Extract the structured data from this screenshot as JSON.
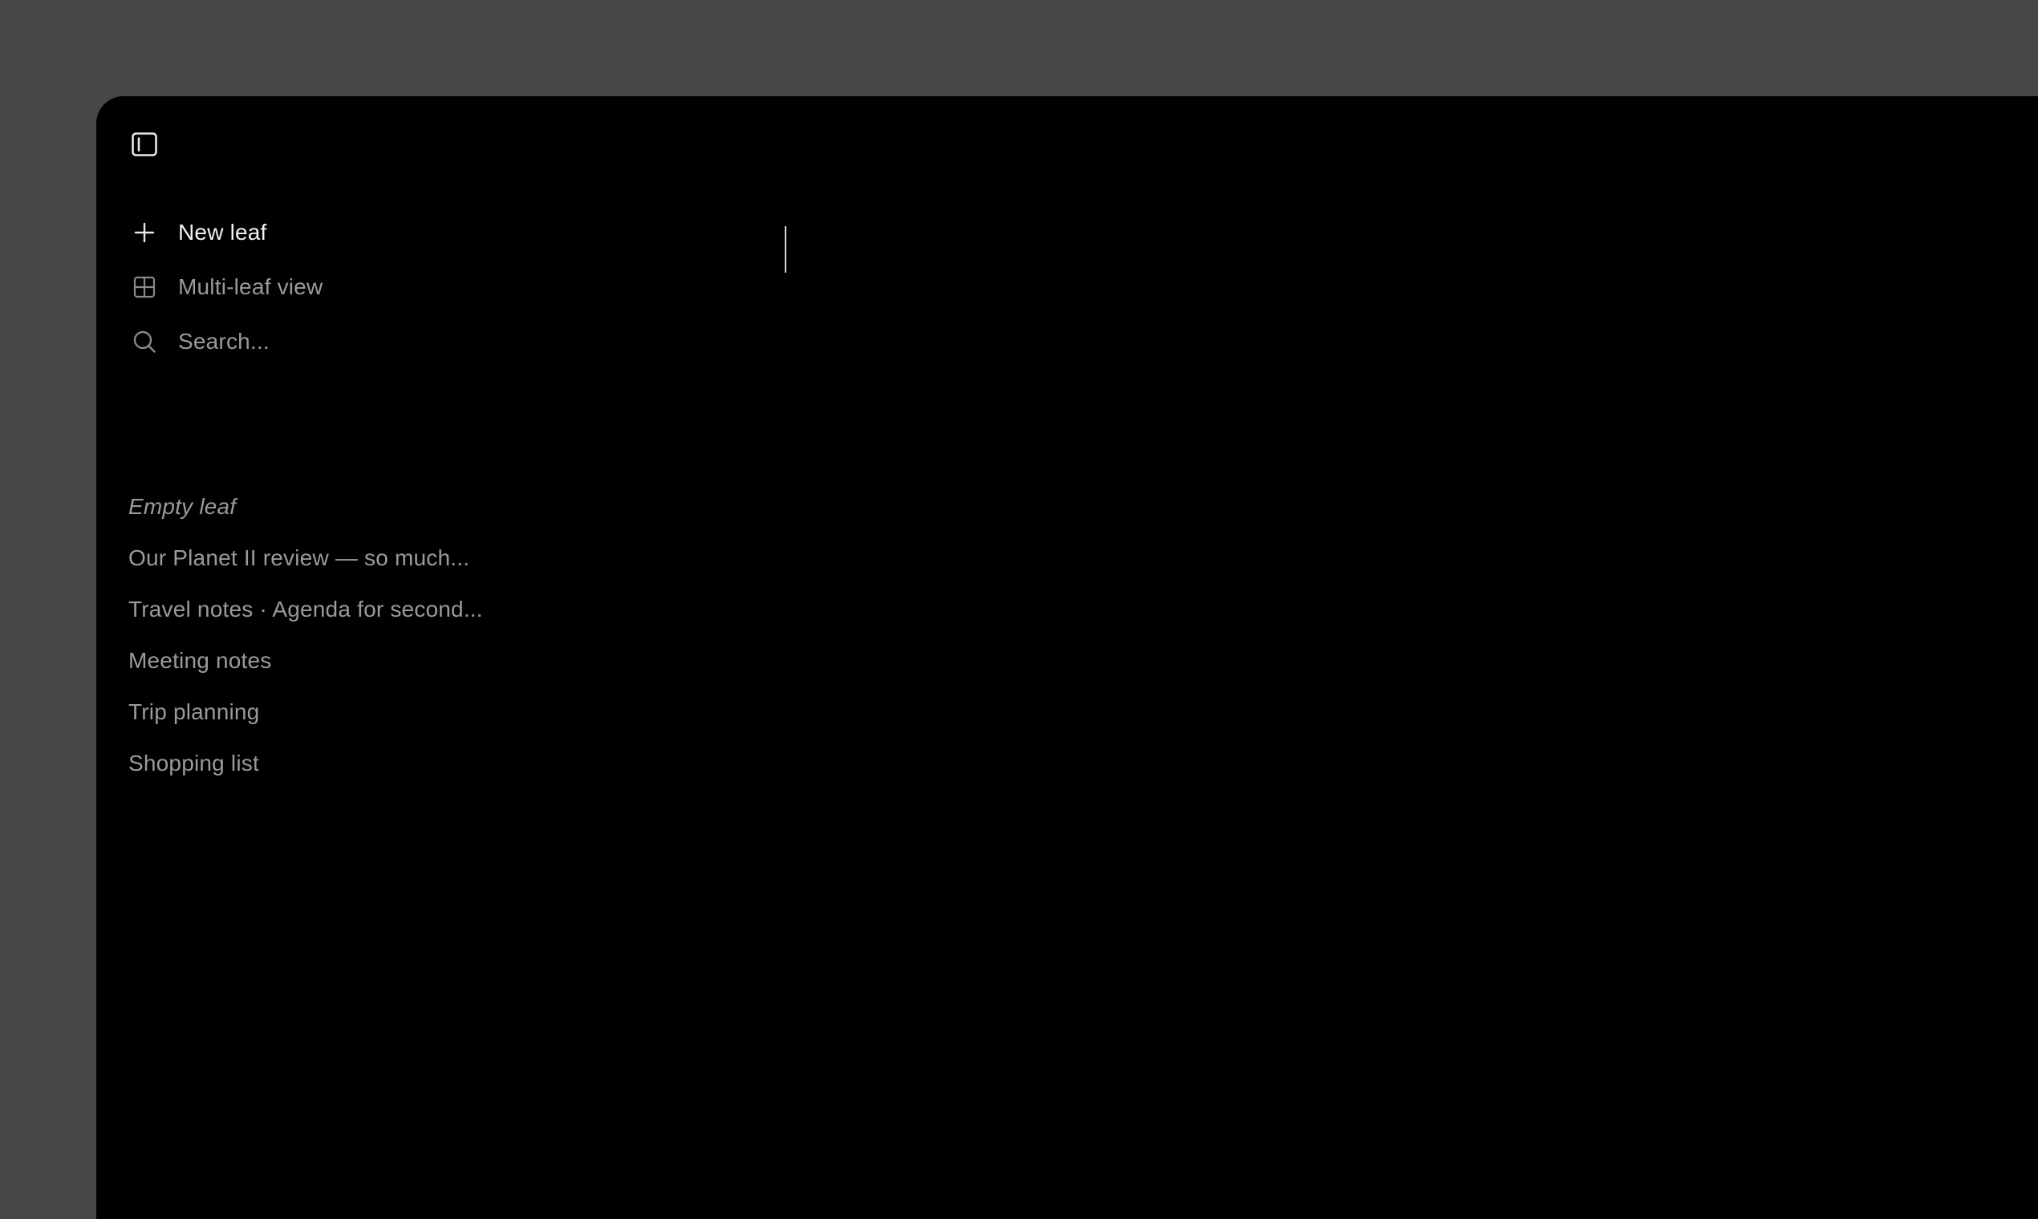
{
  "sidebar": {
    "toggle_icon": "sidebar-panel-icon",
    "nav": [
      {
        "label": "New leaf",
        "icon": "plus-icon"
      },
      {
        "label": "Multi-leaf view",
        "icon": "grid-layout-icon"
      },
      {
        "label": "Search...",
        "icon": "search-icon"
      }
    ],
    "leaves": [
      {
        "title": "Empty leaf"
      },
      {
        "title": "Our Planet II review — so much..."
      },
      {
        "title": "Travel notes · Agenda for second..."
      },
      {
        "title": "Meeting notes"
      },
      {
        "title": "Trip planning"
      },
      {
        "title": "Shopping list"
      }
    ]
  },
  "colors": {
    "background": "#474747",
    "window": "#000000",
    "primary_text": "#f2f2f2",
    "secondary_text": "#9a9a9a"
  }
}
